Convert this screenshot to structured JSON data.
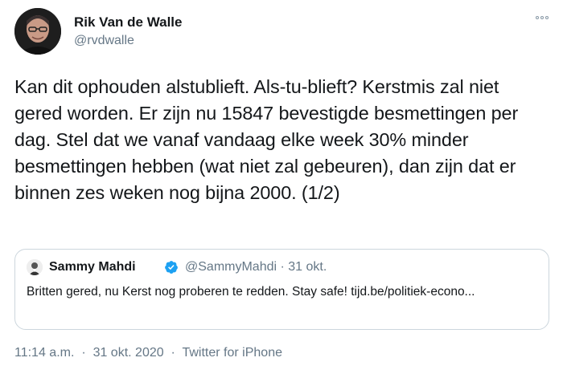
{
  "author": {
    "name": "Rik Van de Walle",
    "handle": "@rvdwalle",
    "avatar_icon": "profile-photo"
  },
  "more_icon": "more-options-icon",
  "tweet_text": "Kan dit ophouden alstublieft. Als-tu-blieft? Kerstmis zal niet gered worden. Er zijn nu 15847 bevestigde besmettingen per dag. Stel dat we vanaf vandaag elke week 30% minder besmettingen hebben (wat niet zal gebeuren), dan zijn dat er binnen zes weken nog bijna 2000. (1/2)",
  "quote": {
    "name": "Sammy Mahdi",
    "verified_icon": "verified-badge-icon",
    "handle": "@SammyMahdi",
    "separator": "·",
    "date": "31 okt.",
    "text": "Britten gered, nu Kerst nog proberen te redden. Stay safe! tijd.be/politiek-econo..."
  },
  "meta": {
    "time": "11:14 a.m.",
    "separator": "·",
    "date": "31 okt. 2020",
    "source": "Twitter for iPhone"
  },
  "colors": {
    "secondary_text": "#657786",
    "primary_text": "#14171a",
    "verified_blue": "#1da1f2",
    "border": "#ccd6dd"
  }
}
